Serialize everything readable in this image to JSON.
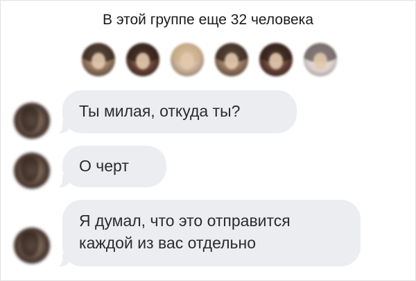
{
  "group": {
    "members_text": "В этой группе еще 32 человека",
    "member_avatars": [
      "avatar",
      "avatar",
      "avatar",
      "avatar",
      "avatar",
      "avatar"
    ]
  },
  "messages": [
    {
      "text_lines": [
        "Ты милая, откуда ты?"
      ],
      "sender_avatar": "avatar"
    },
    {
      "text_lines": [
        "О черт"
      ],
      "sender_avatar": "avatar"
    },
    {
      "text_lines": [
        "Я думал, что это отправится",
        "каждой из вас отдельно"
      ],
      "sender_avatar": "avatar"
    }
  ]
}
